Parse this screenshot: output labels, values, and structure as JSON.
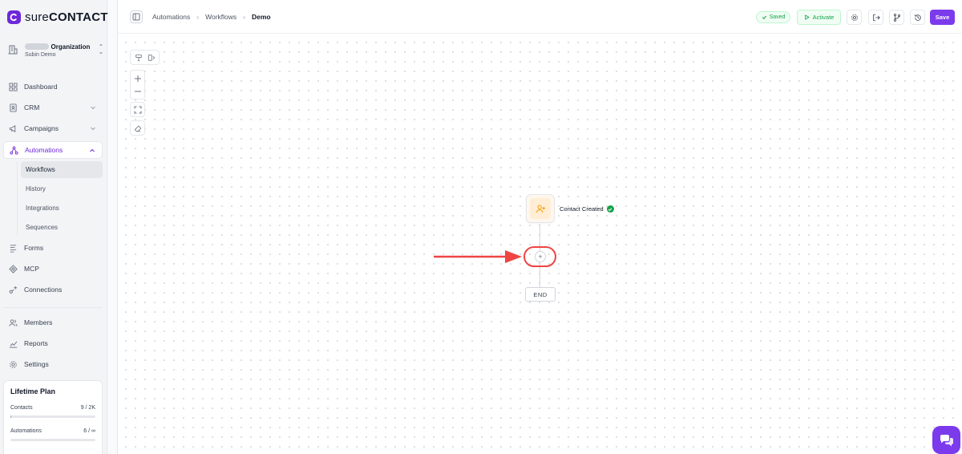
{
  "brand": {
    "name_prefix": "sure",
    "name_suffix": "CONTACT",
    "accent": "#7c3aed"
  },
  "organization": {
    "name": "Organization",
    "sub": "Subin Demo"
  },
  "nav": {
    "dashboard": "Dashboard",
    "crm": "CRM",
    "campaigns": "Campaigns",
    "automations": "Automations",
    "sub": {
      "workflows": "Workflows",
      "history": "History",
      "integrations": "Integrations",
      "sequences": "Sequences"
    },
    "forms": "Forms",
    "mcp": "MCP",
    "connections": "Connections",
    "members": "Members",
    "reports": "Reports",
    "settings": "Settings"
  },
  "plan": {
    "title": "Lifetime Plan",
    "contacts_label": "Contacts",
    "contacts_value": "9 / 2K",
    "contacts_fraction": 0.0045,
    "automations_label": "Automations",
    "automations_value": "6 / ∞",
    "automations_fraction": 0.0
  },
  "breadcrumb": {
    "level1": "Automations",
    "level2": "Workflows",
    "current": "Demo"
  },
  "toolbar": {
    "saved": "Saved",
    "activate": "Activate",
    "save": "Save"
  },
  "workflow": {
    "trigger_label": "Contact Created",
    "trigger_status": "completed",
    "add_step_symbol": "+",
    "end_label": "END"
  },
  "colors": {
    "primary": "#7c3aed",
    "success": "#16a34a",
    "annotation": "#ef4444",
    "trigger_icon": "#f59e0b"
  }
}
